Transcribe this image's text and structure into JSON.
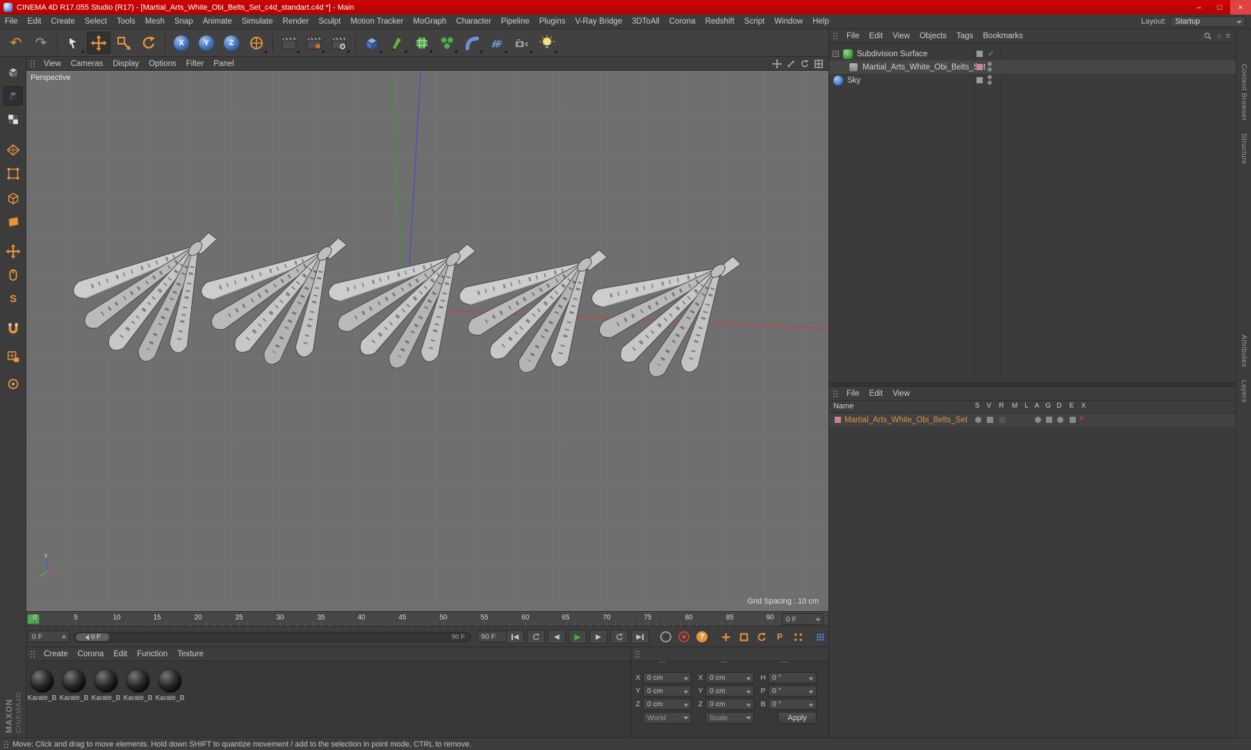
{
  "window": {
    "title": "CINEMA 4D R17.055 Studio (R17) - [Martial_Arts_White_Obi_Belts_Set_c4d_standart.c4d *] - Main",
    "controls": {
      "minimize": "–",
      "maximize": "□",
      "close": "×"
    }
  },
  "menu_bar": {
    "items": [
      "File",
      "Edit",
      "Create",
      "Select",
      "Tools",
      "Mesh",
      "Snap",
      "Animate",
      "Simulate",
      "Render",
      "Sculpt",
      "Motion Tracker",
      "MoGraph",
      "Character",
      "Pipeline",
      "Plugins",
      "V-Ray Bridge",
      "3DToAll",
      "Corona",
      "Redshift",
      "Script",
      "Window",
      "Help"
    ],
    "layout_label": "Layout:",
    "layout_value": "Startup"
  },
  "viewport": {
    "menu": [
      "View",
      "Cameras",
      "Display",
      "Options",
      "Filter",
      "Panel"
    ],
    "camera_label": "Perspective",
    "grid_spacing": "Grid Spacing : 10 cm"
  },
  "object_manager": {
    "menu": [
      "File",
      "Edit",
      "View",
      "Objects",
      "Tags",
      "Bookmarks"
    ],
    "objects": [
      {
        "name": "Subdivision Surface"
      },
      {
        "name": "Martial_Arts_White_Obi_Belts_Set"
      },
      {
        "name": "Sky"
      }
    ]
  },
  "material_list": {
    "menu": [
      "File",
      "Edit",
      "View"
    ],
    "name_header": "Name",
    "columns": [
      "S",
      "V",
      "R",
      "M",
      "L",
      "A",
      "G",
      "D",
      "E",
      "X"
    ],
    "rows": [
      {
        "name": "Martial_Arts_White_Obi_Belts_Set"
      }
    ]
  },
  "timeline": {
    "ticks": [
      "0",
      "5",
      "10",
      "15",
      "20",
      "25",
      "30",
      "35",
      "40",
      "45",
      "50",
      "55",
      "60",
      "65",
      "70",
      "75",
      "80",
      "85",
      "90"
    ],
    "ruler_frame_field": "0 F",
    "start_field": "0 F",
    "marker_label": "0 F",
    "range_end_label": "90 F",
    "end_field": "90 F"
  },
  "materials_panel": {
    "menu": [
      "Create",
      "Corona",
      "Edit",
      "Function",
      "Texture"
    ],
    "items": [
      "Karate_B",
      "Karate_B",
      "Karate_B",
      "Karate_B",
      "Karate_B"
    ]
  },
  "coordinates": {
    "group_headers": [
      "---",
      "---",
      "---"
    ],
    "position": {
      "x_label": "X",
      "y_label": "Y",
      "z_label": "Z",
      "x": "0 cm",
      "y": "0 cm",
      "z": "0 cm"
    },
    "size": {
      "x_label": "X",
      "y_label": "Y",
      "z_label": "Z",
      "x": "0 cm",
      "y": "0 cm",
      "z": "0 cm"
    },
    "rotation": {
      "h_label": "H",
      "p_label": "P",
      "b_label": "B",
      "h": "0 °",
      "p": "0 °",
      "b": "0 °"
    },
    "world_dropdown": "World",
    "scale_dropdown": "Scale",
    "apply_button": "Apply"
  },
  "status_bar": {
    "text": "Move: Click and drag to move elements. Hold down SHIFT to quantize movement / add to the selection in point mode, CTRL to remove."
  },
  "branding": {
    "maxon": "MAXON",
    "cinema4d": "CINEMA4D"
  },
  "right_tabs": [
    "Content Browser",
    "Structure",
    "Attributes",
    "Layers"
  ],
  "icons": {
    "undo": "↶",
    "redo": "↷",
    "help": "?",
    "play": "▶",
    "prev": "◀",
    "next": "▶",
    "snap": "S",
    "parameter": "P",
    "check": "✓",
    "names": [
      "undo-icon",
      "redo-icon",
      "live-selection-icon",
      "move-icon",
      "scale-icon",
      "rotate-icon",
      "x-axis-icon",
      "y-axis-icon",
      "z-axis-icon",
      "coordinate-system-icon",
      "render-view-icon",
      "render-picture-viewer-icon",
      "render-settings-icon",
      "cube-icon",
      "spline-pen-icon",
      "subdivision-surface-icon",
      "cloner-icon",
      "bend-deformer-icon",
      "floor-icon",
      "camera-icon",
      "light-icon",
      "search-icon",
      "magnet-icon",
      "workplane-icon"
    ]
  }
}
